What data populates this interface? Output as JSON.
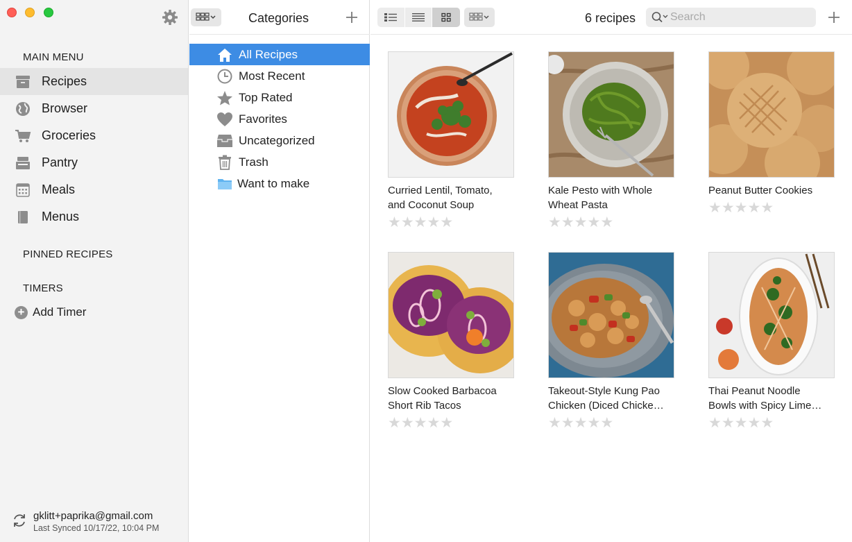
{
  "window": {
    "traffic_lights": [
      "close",
      "minimize",
      "zoom"
    ]
  },
  "sidebar": {
    "main_menu_title": "MAIN MENU",
    "items": [
      {
        "label": "Recipes",
        "icon": "recipe-box-icon",
        "selected": true
      },
      {
        "label": "Browser",
        "icon": "globe-icon",
        "selected": false
      },
      {
        "label": "Groceries",
        "icon": "cart-icon",
        "selected": false
      },
      {
        "label": "Pantry",
        "icon": "pantry-icon",
        "selected": false
      },
      {
        "label": "Meals",
        "icon": "calendar-icon",
        "selected": false
      },
      {
        "label": "Menus",
        "icon": "book-icon",
        "selected": false
      }
    ],
    "pinned_title": "PINNED RECIPES",
    "timers_title": "TIMERS",
    "add_timer_label": "Add Timer",
    "account": "gklitt+paprika@gmail.com",
    "last_synced": "Last Synced 10/17/22, 10:04 PM"
  },
  "categories": {
    "title": "Categories",
    "items": [
      {
        "label": "All Recipes",
        "icon": "home-icon",
        "selected": true
      },
      {
        "label": "Most Recent",
        "icon": "clock-icon",
        "selected": false
      },
      {
        "label": "Top Rated",
        "icon": "star-icon",
        "selected": false
      },
      {
        "label": "Favorites",
        "icon": "heart-icon",
        "selected": false
      },
      {
        "label": "Uncategorized",
        "icon": "tray-icon",
        "selected": false
      },
      {
        "label": "Trash",
        "icon": "trash-icon",
        "selected": false
      },
      {
        "label": "Want to make",
        "icon": "folder-icon",
        "selected": false
      }
    ]
  },
  "toolbar": {
    "view_modes": [
      "detailed-list",
      "list",
      "grid"
    ],
    "active_view": "grid",
    "recipe_count": "6 recipes",
    "search_placeholder": "Search",
    "search_value": ""
  },
  "recipes": [
    {
      "name": "Curried Lentil, Tomato, and Coconut Soup",
      "name_display_line1": "Curried Lentil, Tomato,",
      "name_display_line2": "and Coconut Soup",
      "rating": 0,
      "photo": "red-soup-bowl"
    },
    {
      "name": "Kale Pesto with Whole Wheat Pasta",
      "name_display_line1": "Kale Pesto with Whole",
      "name_display_line2": "Wheat Pasta",
      "rating": 0,
      "photo": "green-pasta-bowl"
    },
    {
      "name": "Peanut Butter Cookies",
      "name_display_line1": "Peanut Butter Cookies",
      "name_display_line2": "",
      "rating": 0,
      "photo": "cookies"
    },
    {
      "name": "Slow Cooked Barbacoa Short Rib Tacos",
      "name_display_line1": "Slow Cooked Barbacoa",
      "name_display_line2": "Short Rib Tacos",
      "rating": 0,
      "photo": "tacos"
    },
    {
      "name": "Takeout-Style Kung Pao Chicken (Diced Chicke…",
      "name_display_line1": "Takeout-Style Kung Pao",
      "name_display_line2": "Chicken (Diced Chicke…",
      "rating": 0,
      "photo": "kung-pao-plate"
    },
    {
      "name": "Thai Peanut Noodle Bowls with Spicy Lime…",
      "name_display_line1": "Thai Peanut Noodle",
      "name_display_line2": "Bowls with Spicy Lime…",
      "rating": 0,
      "photo": "noodle-platter"
    }
  ],
  "colors": {
    "selection_blue": "#3d8ce4",
    "sidebar_bg": "#f3f3f3",
    "star_empty": "#d8d8d8"
  }
}
